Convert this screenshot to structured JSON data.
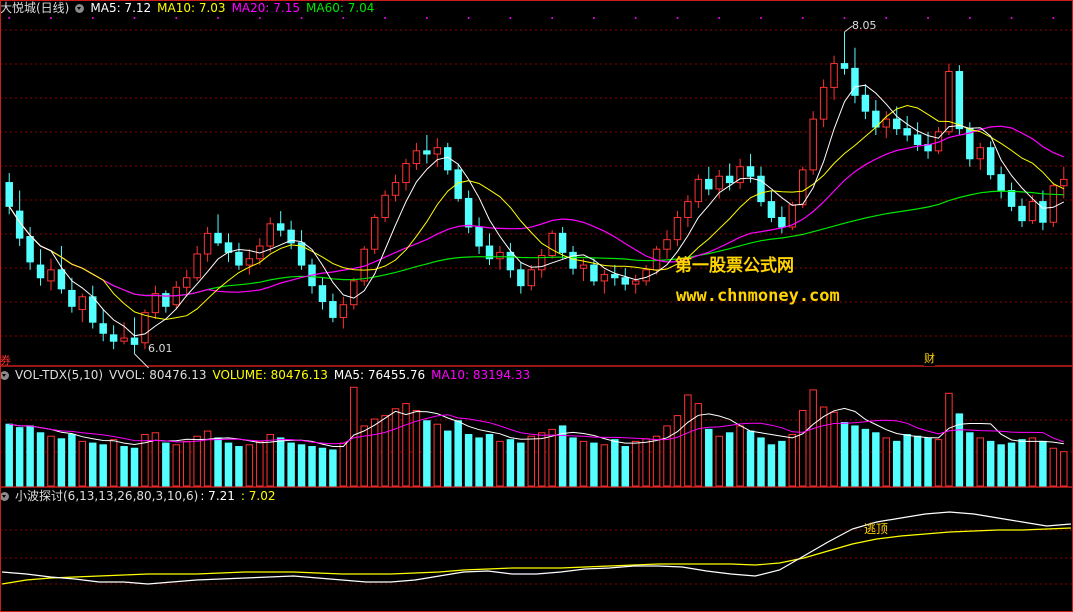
{
  "main": {
    "title": "大悦城(日线)",
    "ma5": "MA5: 7.12",
    "ma10": "MA10: 7.03",
    "ma20": "MA20: 7.15",
    "ma60": "MA60: 7.04",
    "high_label": "8.05",
    "low_label": "6.01",
    "fin_marker": "财",
    "left_marker": "券"
  },
  "volume": {
    "name": "VOL-TDX(5,10)",
    "vvol": "VVOL: 80476.13",
    "volume": "VOLUME: 80476.13",
    "ma5": "MA5: 76455.76",
    "ma10": "MA10: 83194.33"
  },
  "indicator": {
    "name": "小波探讨(6,13,13,26,80,3,10,6)",
    "v1": ": 7.21",
    "v2": ": 7.02",
    "annotation": "逃顶"
  },
  "watermark": {
    "line1": "第一股票公式网",
    "line2": "www.chnmoney.com"
  },
  "colors": {
    "up": "#ff3232",
    "down": "#54ffff",
    "ma5": "#ffffff",
    "ma10": "#ffff00",
    "ma20": "#ff00ff",
    "ma60": "#00e600",
    "grid": "#8b0000",
    "border": "#c81e1e"
  },
  "chart_data": {
    "type": "candlestick",
    "ylim": [
      5.95,
      8.15
    ],
    "ohlc": [
      [
        7.1,
        7.16,
        6.9,
        6.95
      ],
      [
        6.92,
        7.05,
        6.7,
        6.75
      ],
      [
        6.76,
        6.82,
        6.55,
        6.6
      ],
      [
        6.58,
        6.68,
        6.45,
        6.5
      ],
      [
        6.48,
        6.62,
        6.42,
        6.55
      ],
      [
        6.55,
        6.7,
        6.4,
        6.43
      ],
      [
        6.42,
        6.5,
        6.28,
        6.32
      ],
      [
        6.3,
        6.4,
        6.22,
        6.38
      ],
      [
        6.38,
        6.45,
        6.18,
        6.22
      ],
      [
        6.21,
        6.3,
        6.1,
        6.15
      ],
      [
        6.14,
        6.2,
        6.05,
        6.1
      ],
      [
        6.1,
        6.22,
        6.08,
        6.12
      ],
      [
        6.12,
        6.25,
        6.02,
        6.08
      ],
      [
        6.09,
        6.3,
        6.05,
        6.28
      ],
      [
        6.28,
        6.45,
        6.24,
        6.4
      ],
      [
        6.4,
        6.42,
        6.28,
        6.32
      ],
      [
        6.33,
        6.48,
        6.3,
        6.44
      ],
      [
        6.44,
        6.55,
        6.38,
        6.5
      ],
      [
        6.5,
        6.7,
        6.48,
        6.65
      ],
      [
        6.65,
        6.82,
        6.6,
        6.78
      ],
      [
        6.78,
        6.9,
        6.7,
        6.72
      ],
      [
        6.72,
        6.78,
        6.6,
        6.66
      ],
      [
        6.66,
        6.72,
        6.55,
        6.58
      ],
      [
        6.58,
        6.68,
        6.52,
        6.62
      ],
      [
        6.62,
        6.75,
        6.58,
        6.7
      ],
      [
        6.7,
        6.88,
        6.66,
        6.84
      ],
      [
        6.84,
        6.92,
        6.76,
        6.8
      ],
      [
        6.8,
        6.86,
        6.68,
        6.72
      ],
      [
        6.72,
        6.8,
        6.55,
        6.58
      ],
      [
        6.58,
        6.62,
        6.4,
        6.45
      ],
      [
        6.45,
        6.5,
        6.3,
        6.35
      ],
      [
        6.35,
        6.4,
        6.22,
        6.25
      ],
      [
        6.25,
        6.38,
        6.18,
        6.33
      ],
      [
        6.33,
        6.5,
        6.3,
        6.48
      ],
      [
        6.48,
        6.7,
        6.45,
        6.68
      ],
      [
        6.68,
        6.9,
        6.65,
        6.88
      ],
      [
        6.88,
        7.05,
        6.85,
        7.02
      ],
      [
        7.02,
        7.15,
        6.98,
        7.1
      ],
      [
        7.1,
        7.25,
        7.05,
        7.22
      ],
      [
        7.22,
        7.35,
        7.18,
        7.3
      ],
      [
        7.3,
        7.4,
        7.22,
        7.28
      ],
      [
        7.28,
        7.38,
        7.2,
        7.32
      ],
      [
        7.32,
        7.35,
        7.15,
        7.18
      ],
      [
        7.18,
        7.22,
        6.98,
        7.0
      ],
      [
        7.0,
        7.05,
        6.78,
        6.82
      ],
      [
        6.82,
        6.88,
        6.65,
        6.7
      ],
      [
        6.7,
        6.78,
        6.58,
        6.62
      ],
      [
        6.62,
        6.7,
        6.55,
        6.66
      ],
      [
        6.66,
        6.72,
        6.5,
        6.55
      ],
      [
        6.55,
        6.6,
        6.4,
        6.45
      ],
      [
        6.45,
        6.58,
        6.42,
        6.55
      ],
      [
        6.55,
        6.68,
        6.5,
        6.64
      ],
      [
        6.64,
        6.8,
        6.62,
        6.78
      ],
      [
        6.78,
        6.82,
        6.62,
        6.66
      ],
      [
        6.66,
        6.7,
        6.52,
        6.56
      ],
      [
        6.56,
        6.62,
        6.48,
        6.58
      ],
      [
        6.58,
        6.62,
        6.45,
        6.48
      ],
      [
        6.48,
        6.55,
        6.4,
        6.52
      ],
      [
        6.52,
        6.58,
        6.45,
        6.5
      ],
      [
        6.5,
        6.56,
        6.42,
        6.46
      ],
      [
        6.46,
        6.52,
        6.4,
        6.48
      ],
      [
        6.48,
        6.58,
        6.45,
        6.55
      ],
      [
        6.55,
        6.7,
        6.52,
        6.68
      ],
      [
        6.68,
        6.8,
        6.62,
        6.74
      ],
      [
        6.74,
        6.92,
        6.7,
        6.88
      ],
      [
        6.88,
        7.02,
        6.82,
        6.98
      ],
      [
        6.98,
        7.15,
        6.94,
        7.12
      ],
      [
        7.12,
        7.2,
        7.02,
        7.06
      ],
      [
        7.06,
        7.18,
        7.0,
        7.14
      ],
      [
        7.14,
        7.22,
        7.05,
        7.1
      ],
      [
        7.1,
        7.25,
        7.06,
        7.2
      ],
      [
        7.2,
        7.28,
        7.1,
        7.14
      ],
      [
        7.14,
        7.2,
        6.95,
        6.98
      ],
      [
        6.98,
        7.05,
        6.85,
        6.88
      ],
      [
        6.88,
        6.95,
        6.78,
        6.82
      ],
      [
        6.82,
        6.98,
        6.8,
        6.96
      ],
      [
        6.96,
        7.2,
        6.94,
        7.18
      ],
      [
        7.18,
        7.55,
        7.15,
        7.5
      ],
      [
        7.5,
        7.75,
        7.45,
        7.7
      ],
      [
        7.7,
        7.9,
        7.62,
        7.85
      ],
      [
        7.85,
        8.05,
        7.78,
        7.82
      ],
      [
        7.82,
        7.95,
        7.6,
        7.65
      ],
      [
        7.65,
        7.72,
        7.5,
        7.55
      ],
      [
        7.55,
        7.62,
        7.4,
        7.45
      ],
      [
        7.45,
        7.55,
        7.38,
        7.5
      ],
      [
        7.5,
        7.58,
        7.4,
        7.44
      ],
      [
        7.44,
        7.52,
        7.36,
        7.4
      ],
      [
        7.4,
        7.48,
        7.3,
        7.34
      ],
      [
        7.34,
        7.42,
        7.25,
        7.3
      ],
      [
        7.3,
        7.45,
        7.28,
        7.42
      ],
      [
        7.42,
        7.85,
        7.4,
        7.8
      ],
      [
        7.8,
        7.84,
        7.4,
        7.44
      ],
      [
        7.44,
        7.48,
        7.2,
        7.25
      ],
      [
        7.25,
        7.35,
        7.18,
        7.32
      ],
      [
        7.32,
        7.36,
        7.12,
        7.15
      ],
      [
        7.15,
        7.2,
        7.0,
        7.05
      ],
      [
        7.05,
        7.1,
        6.92,
        6.95
      ],
      [
        6.95,
        7.0,
        6.82,
        6.86
      ],
      [
        6.86,
        7.02,
        6.84,
        6.98
      ],
      [
        6.98,
        7.05,
        6.8,
        6.85
      ],
      [
        6.85,
        7.1,
        6.82,
        7.08
      ],
      [
        7.08,
        7.2,
        7.0,
        7.12
      ]
    ],
    "vol": [
      72,
      68,
      70,
      62,
      58,
      55,
      60,
      52,
      50,
      48,
      54,
      46,
      44,
      60,
      62,
      50,
      48,
      52,
      58,
      64,
      56,
      50,
      46,
      48,
      52,
      60,
      56,
      50,
      48,
      46,
      44,
      42,
      50,
      115,
      70,
      78,
      82,
      90,
      96,
      88,
      76,
      72,
      64,
      76,
      60,
      56,
      60,
      52,
      54,
      50,
      58,
      62,
      66,
      70,
      56,
      52,
      50,
      48,
      54,
      46,
      52,
      55,
      58,
      70,
      82,
      106,
      96,
      66,
      58,
      62,
      70,
      64,
      56,
      48,
      52,
      60,
      88,
      112,
      92,
      86,
      74,
      70,
      66,
      62,
      56,
      52,
      60,
      58,
      56,
      54,
      108,
      84,
      62,
      56,
      52,
      48,
      50,
      54,
      56,
      52,
      44,
      40
    ],
    "vol_up": [
      0,
      0,
      0,
      0,
      1,
      0,
      0,
      1,
      0,
      0,
      1,
      0,
      0,
      1,
      1,
      0,
      1,
      1,
      1,
      1,
      0,
      0,
      0,
      1,
      1,
      1,
      0,
      0,
      0,
      0,
      0,
      0,
      1,
      1,
      1,
      1,
      1,
      1,
      1,
      1,
      0,
      1,
      0,
      0,
      0,
      0,
      0,
      1,
      0,
      0,
      1,
      1,
      1,
      0,
      0,
      1,
      0,
      1,
      0,
      0,
      1,
      1,
      1,
      1,
      1,
      1,
      1,
      0,
      1,
      0,
      1,
      0,
      0,
      0,
      0,
      1,
      1,
      1,
      1,
      1,
      0,
      0,
      0,
      0,
      1,
      0,
      0,
      0,
      0,
      1,
      1,
      0,
      0,
      1,
      0,
      0,
      0,
      0,
      1,
      0,
      1,
      1
    ],
    "wave_white": [
      0.32,
      0.3,
      0.27,
      0.25,
      0.22,
      0.22,
      0.2,
      0.22,
      0.24,
      0.25,
      0.26,
      0.27,
      0.28,
      0.26,
      0.24,
      0.22,
      0.22,
      0.24,
      0.28,
      0.32,
      0.33,
      0.3,
      0.3,
      0.32,
      0.35,
      0.36,
      0.38,
      0.38,
      0.37,
      0.33,
      0.3,
      0.28,
      0.34,
      0.48,
      0.62,
      0.75,
      0.82,
      0.86,
      0.9,
      0.92,
      0.9,
      0.86,
      0.82,
      0.78,
      0.8
    ],
    "wave_yellow": [
      0.2,
      0.24,
      0.26,
      0.27,
      0.28,
      0.29,
      0.3,
      0.3,
      0.3,
      0.31,
      0.32,
      0.32,
      0.32,
      0.31,
      0.3,
      0.3,
      0.3,
      0.31,
      0.32,
      0.34,
      0.35,
      0.36,
      0.36,
      0.36,
      0.37,
      0.38,
      0.39,
      0.4,
      0.4,
      0.4,
      0.4,
      0.39,
      0.41,
      0.46,
      0.53,
      0.6,
      0.65,
      0.68,
      0.7,
      0.72,
      0.73,
      0.74,
      0.74,
      0.75,
      0.76
    ]
  }
}
